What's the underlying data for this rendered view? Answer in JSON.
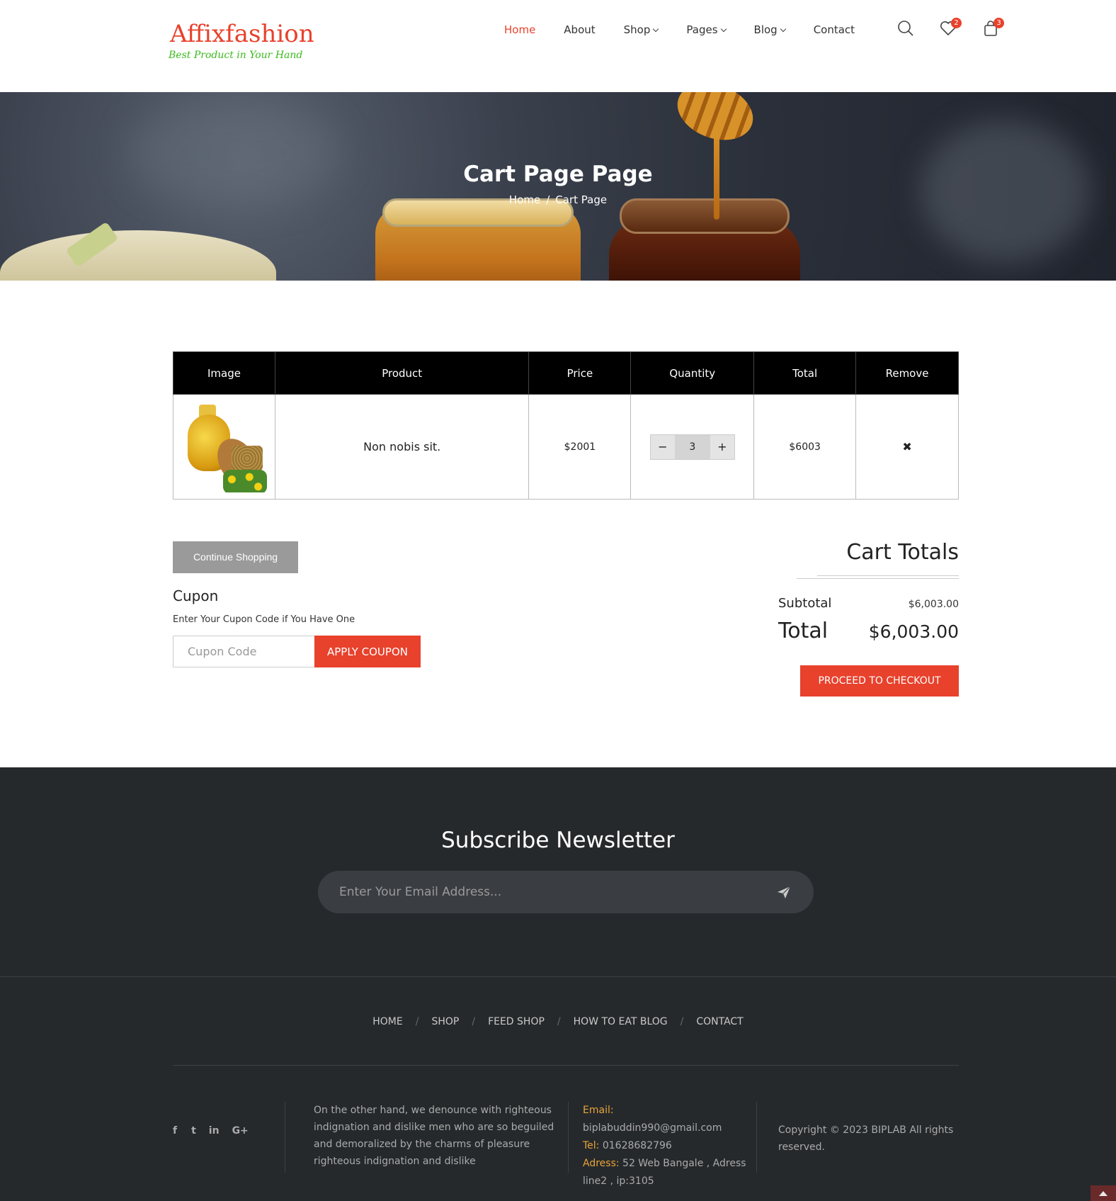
{
  "header": {
    "logo_main": "Affixfashion",
    "logo_sub": "Best Product in Your Hand",
    "nav": [
      {
        "label": "Home",
        "active": true,
        "dropdown": false
      },
      {
        "label": "About",
        "active": false,
        "dropdown": false
      },
      {
        "label": "Shop",
        "active": false,
        "dropdown": true
      },
      {
        "label": "Pages",
        "active": false,
        "dropdown": true
      },
      {
        "label": "Blog",
        "active": false,
        "dropdown": true
      },
      {
        "label": "Contact",
        "active": false,
        "dropdown": false
      }
    ],
    "wishlist_count": "2",
    "cart_count": "3"
  },
  "banner": {
    "title": "Cart Page Page",
    "crumb_home": "Home",
    "crumb_sep": "/",
    "crumb_current": "Cart Page"
  },
  "cart": {
    "headers": [
      "Image",
      "Product",
      "Price",
      "Quantity",
      "Total",
      "Remove"
    ],
    "rows": [
      {
        "product": "Non nobis sit.",
        "price": "$2001",
        "quantity": "3",
        "total": "$6003"
      }
    ],
    "minus": "−",
    "plus": "+",
    "remove_icon": "✖"
  },
  "actions": {
    "continue_label": "Continue Shopping",
    "cupon_title": "Cupon",
    "cupon_desc": "Enter Your Cupon Code if You Have One",
    "cupon_placeholder": "Cupon Code",
    "apply_label": "APPLY COUPON"
  },
  "totals": {
    "title": "Cart Totals",
    "subtotal_label": "Subtotal",
    "subtotal_value": "$6,003.00",
    "total_label": "Total",
    "total_value": "$6,003.00",
    "checkout_label": "PROCEED TO CHECKOUT"
  },
  "footer": {
    "newsletter_title": "Subscribe Newsletter",
    "email_placeholder": "Enter Your Email Address...",
    "nav": [
      "HOME",
      "SHOP",
      "FEED SHOP",
      "HOW TO EAT BLOG",
      "CONTACT"
    ],
    "nav_sep": "/",
    "social": [
      "f",
      "t",
      "in",
      "G+"
    ],
    "about": "On the other hand, we denounce with righteous indignation and dislike men who are so beguiled and demoralized by the charms of pleasure righteous indignation and dislike",
    "email_label": "Email:",
    "email": "biplabuddin990@gmail.com",
    "tel_label": "Tel:",
    "tel": "01628682796",
    "address_label": "Adress:",
    "address": "52 Web Bangale , Adress line2 , ip:3105",
    "copyright": "Copyright © 2023 BIPLAB All rights reserved."
  },
  "colors": {
    "accent": "#e8412c",
    "logo_sub": "#3dbb1e",
    "footer_bg": "#26292c"
  }
}
